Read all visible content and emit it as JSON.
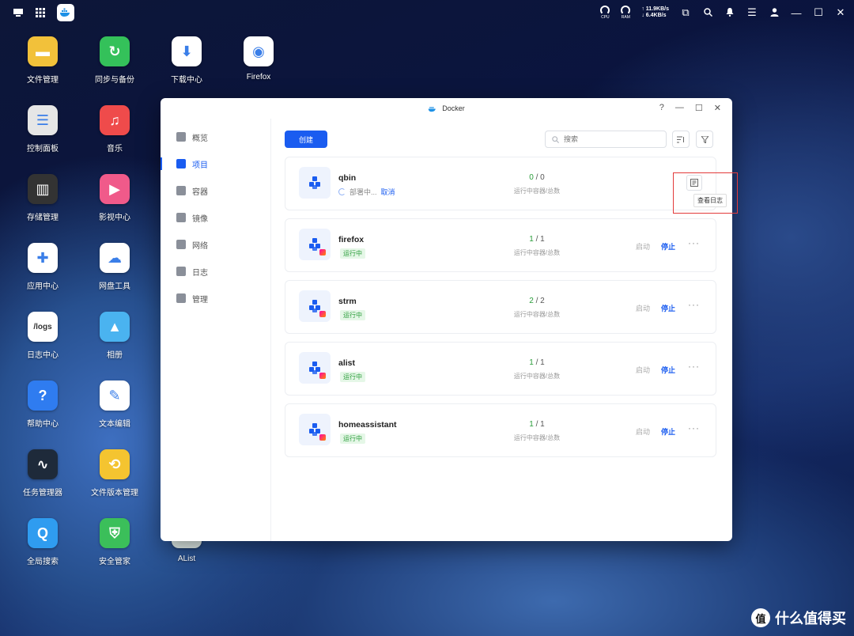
{
  "topbar": {
    "net_up": "↑ 11.9KB/s",
    "net_down": "↓ 6.4KB/s",
    "cpu_label": "CPU",
    "ram_label": "RAM"
  },
  "desktop": {
    "icons": [
      {
        "label": "文件管理",
        "color": "#f2c13a",
        "glyph": "▬"
      },
      {
        "label": "同步与备份",
        "color": "#34c15a",
        "glyph": "↻"
      },
      {
        "label": "下载中心",
        "color": "#ffffff",
        "glyph": "⬇"
      },
      {
        "label": "Firefox",
        "color": "#ffffff",
        "glyph": "◉"
      },
      {
        "label": "控制面板",
        "color": "#e6e6e6",
        "glyph": "☰"
      },
      {
        "label": "音乐",
        "color": "#ef4b4b",
        "glyph": "♫"
      },
      {
        "label": "存储管理",
        "color": "#333333",
        "glyph": "▥"
      },
      {
        "label": "影视中心",
        "color": "#f05a8a",
        "glyph": "▶"
      },
      {
        "label": "应用中心",
        "color": "#ffffff",
        "glyph": "✚"
      },
      {
        "label": "网盘工具",
        "color": "#ffffff",
        "glyph": "☁"
      },
      {
        "label": "日志中心",
        "color": "#ffffff",
        "glyph": "/logs"
      },
      {
        "label": "相册",
        "color": "#4ab3f0",
        "glyph": "▲"
      },
      {
        "label": "帮助中心",
        "color": "#2f7cf0",
        "glyph": "?"
      },
      {
        "label": "文本编辑",
        "color": "#ffffff",
        "glyph": "✎"
      },
      {
        "label": "任务管理器",
        "color": "#1e2a3a",
        "glyph": "∿"
      },
      {
        "label": "文件版本管理",
        "color": "#f4c430",
        "glyph": "⟲"
      },
      {
        "label": "全局搜索",
        "color": "#2f9cf0",
        "glyph": "Q"
      },
      {
        "label": "安全管家",
        "color": "#3bbf5a",
        "glyph": "⛨"
      },
      {
        "label": "AList",
        "color": "#e8f4f0",
        "glyph": ""
      }
    ]
  },
  "window": {
    "title": "Docker",
    "help": "?",
    "sidebar": [
      {
        "label": "概览",
        "active": false
      },
      {
        "label": "项目",
        "active": true
      },
      {
        "label": "容器",
        "active": false
      },
      {
        "label": "镜像",
        "active": false
      },
      {
        "label": "网络",
        "active": false
      },
      {
        "label": "日志",
        "active": false
      },
      {
        "label": "管理",
        "active": false
      }
    ],
    "create_label": "创建",
    "search_placeholder": "搜索",
    "counts_caption": "运行中容器/总数",
    "start_label": "启动",
    "stop_label": "停止",
    "projects": [
      {
        "name": "qbin",
        "running": "0",
        "total": "0",
        "status": "部署中...",
        "cancel": "取消",
        "deploying": true
      },
      {
        "name": "firefox",
        "running": "1",
        "total": "1",
        "status": "运行中",
        "deploying": false
      },
      {
        "name": "strm",
        "running": "2",
        "total": "2",
        "status": "运行中",
        "deploying": false
      },
      {
        "name": "alist",
        "running": "1",
        "total": "1",
        "status": "运行中",
        "deploying": false
      },
      {
        "name": "homeassistant",
        "running": "1",
        "total": "1",
        "status": "运行中",
        "deploying": false
      }
    ],
    "tooltip": "查看日志"
  },
  "watermark": {
    "text": "什么值得买",
    "logo": "值"
  }
}
